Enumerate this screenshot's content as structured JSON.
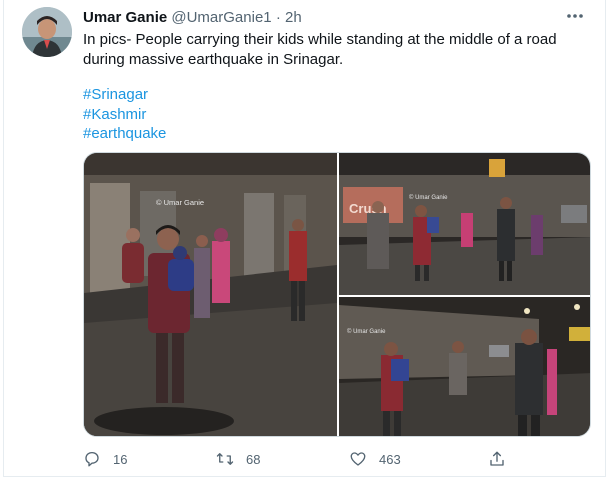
{
  "tweet": {
    "author_name": "Umar Ganie",
    "handle": "@UmarGanie1",
    "separator": "·",
    "time": "2h",
    "text": "In pics- People carrying their kids while standing at the middle of a road\nduring massive earthquake in Srinagar.",
    "hashtags": [
      "#Srinagar",
      "#Kashmir",
      "#earthquake"
    ],
    "media_watermark": "© Umar Ganie",
    "shop_sign": "Crush"
  },
  "actions": {
    "replies": "16",
    "retweets": "68",
    "likes": "463"
  },
  "colors": {
    "link": "#1b95e0",
    "secondary_text": "#536471",
    "border": "#e6ecf0"
  },
  "icons": [
    "more-icon",
    "reply-icon",
    "retweet-icon",
    "like-icon",
    "share-icon"
  ]
}
